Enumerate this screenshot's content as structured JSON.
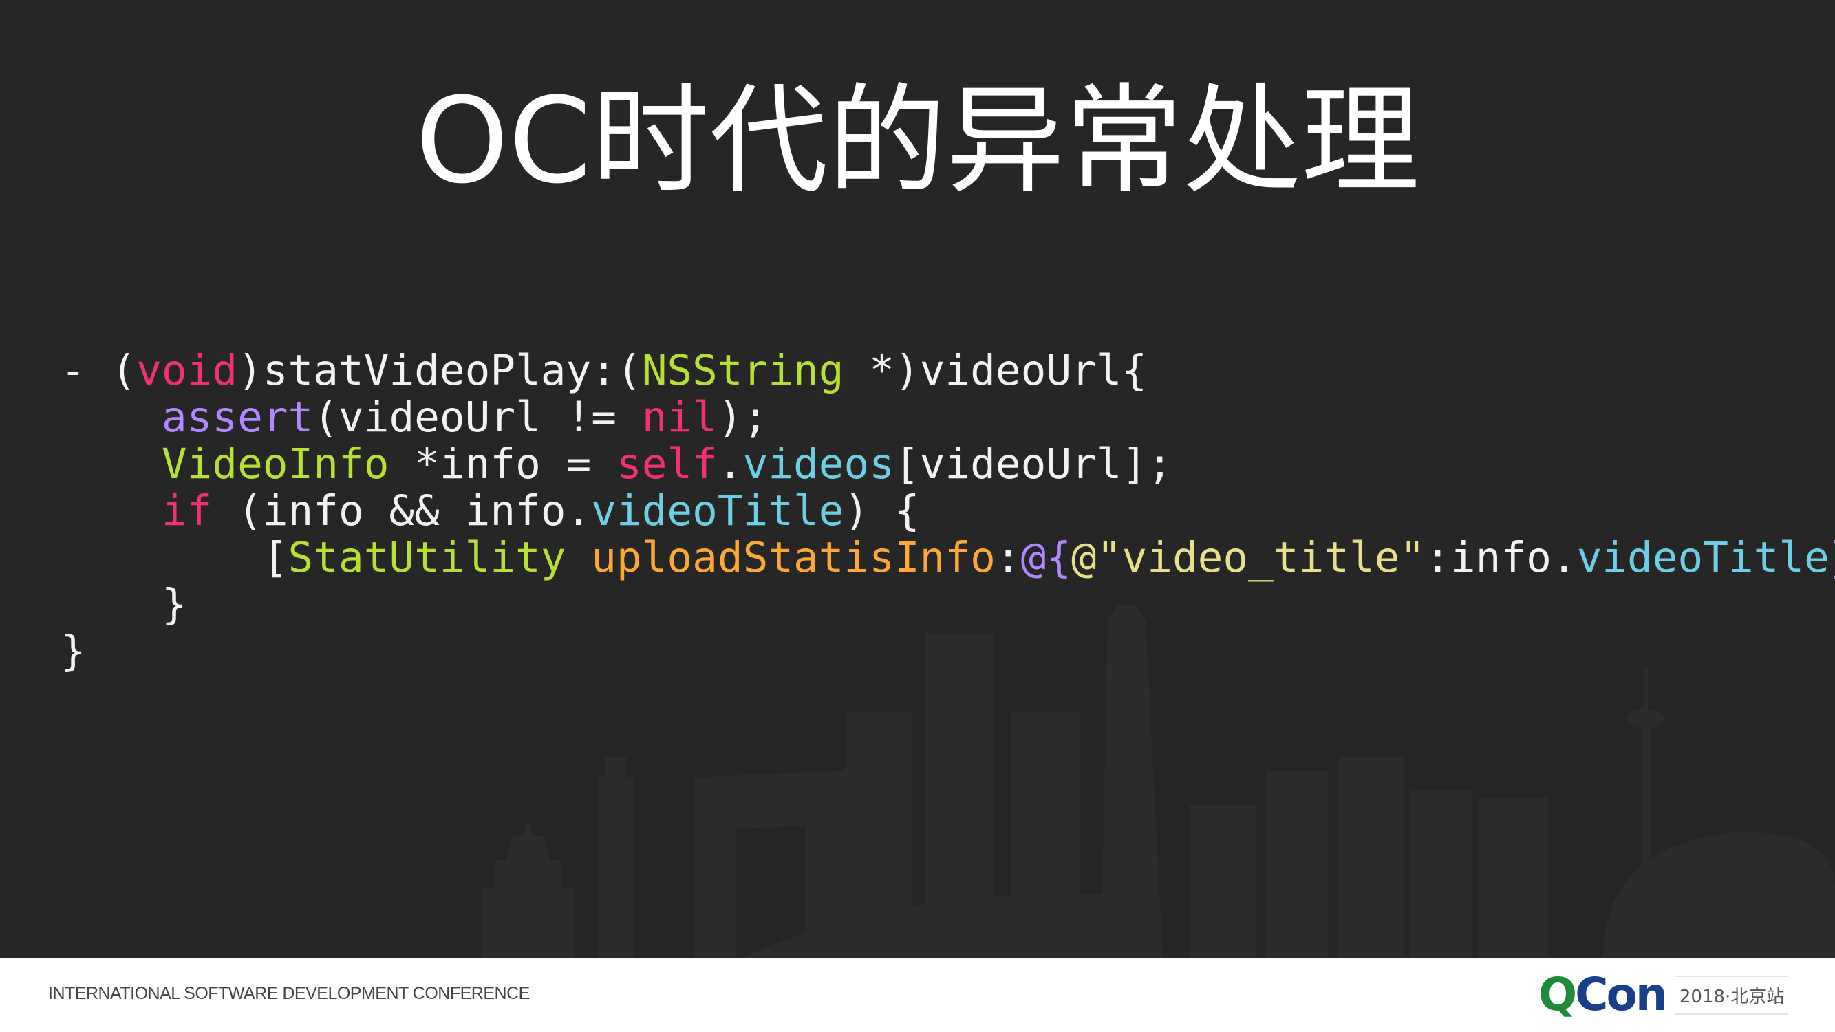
{
  "slide": {
    "title": "OC时代的异常处理"
  },
  "code": {
    "l1": {
      "a": "- (",
      "b": "void",
      "c": ")statVideoPlay:(",
      "d": "NSString",
      "e": " *)videoUrl{"
    },
    "l2": {
      "a": "    ",
      "b": "assert",
      "c": "(videoUrl != ",
      "d": "nil",
      "e": ");"
    },
    "l3": {
      "a": "    ",
      "b": "VideoInfo",
      "c": " *info = ",
      "d": "self",
      "e": ".",
      "f": "videos",
      "g": "[videoUrl];"
    },
    "l4": {
      "a": "    ",
      "b": "if",
      "c": " (info && info.",
      "d": "videoTitle",
      "e": ") {"
    },
    "l5": {
      "a": "        [",
      "b": "StatUtility",
      "c": " ",
      "d": "uploadStatisInfo",
      "e": ":",
      "f": "@{",
      "g": "@\"video_title\"",
      "h": ":info.",
      "i": "videoTitle",
      "j": "}",
      "k": "];"
    },
    "l6": {
      "a": "    }"
    },
    "l7": {
      "a": "}"
    }
  },
  "footer": {
    "conference": "INTERNATIONAL SOFTWARE DEVELOPMENT CONFERENCE",
    "brand_q": "Q",
    "brand_con": "Con",
    "edition": "2018·北京站"
  },
  "colors": {
    "background": "#262626",
    "keyword": "#f0336e",
    "type": "#b6e033",
    "function": "#b388ff",
    "property": "#6ccfe6",
    "method": "#ffa733",
    "string": "#e8e088",
    "brand_green": "#1f8a3a",
    "brand_blue": "#1a3f8a"
  }
}
